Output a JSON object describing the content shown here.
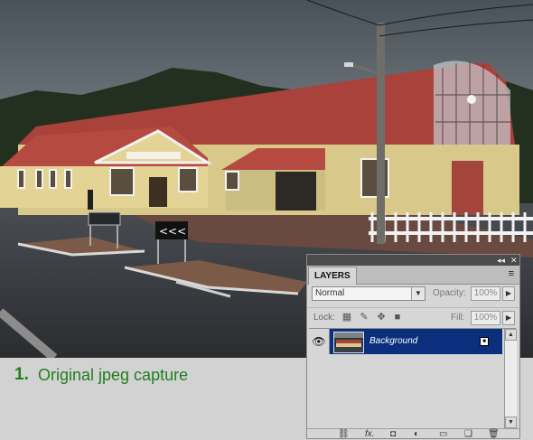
{
  "caption": {
    "number": "1.",
    "text": "Original jpeg capture"
  },
  "panel": {
    "tab_label": "LAYERS",
    "collapse_icon": "◂◂",
    "close_icon": "✕",
    "menu_icon": "≡",
    "blend_mode": "Normal",
    "opacity_label": "Opacity:",
    "opacity_value": "100%",
    "lock_label": "Lock:",
    "fill_label": "Fill:",
    "fill_value": "100%",
    "layers": [
      {
        "name": "Background",
        "visible": true,
        "locked": true
      }
    ],
    "bottom_icons": [
      "link-layers-icon",
      "fx-icon",
      "add-mask-icon",
      "adjustment-layer-icon",
      "new-group-icon",
      "new-layer-icon",
      "trash-icon"
    ]
  },
  "colors": {
    "caption_green": "#1f7f1f",
    "layer_selected": "#0b2e7d"
  }
}
